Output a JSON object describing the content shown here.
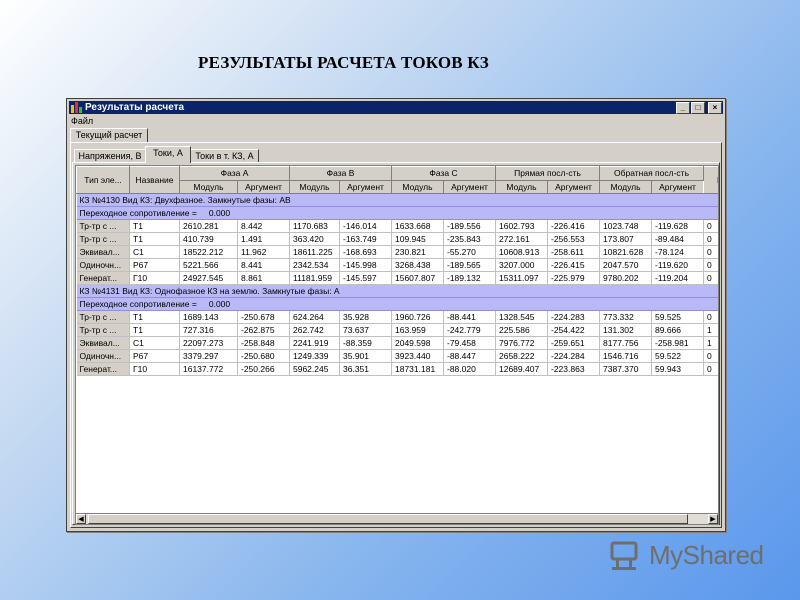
{
  "slide": {
    "title": "РЕЗУЛЬТАТЫ РАСЧЕТА ТОКОВ КЗ"
  },
  "window": {
    "title": "Результаты расчета",
    "menu": [
      "Файл"
    ],
    "outer_tab": "Текущий расчет",
    "tabs": [
      "Напряжения, В",
      "Токи, А",
      "Токи в т. КЗ, А"
    ],
    "active_tab": "Токи, А"
  },
  "table": {
    "group_headers": [
      "Тип эле...",
      "Название",
      "Фаза A",
      "Фаза B",
      "Фаза C",
      "Прямая посл-сть",
      "Обратная посл-сть",
      "Н"
    ],
    "sub_headers": [
      "Модуль",
      "Аргумент"
    ],
    "sections": [
      {
        "header": "КЗ №4130 Вид КЗ: Двухфазное. Замкнутые фазы: AB",
        "resistance_label": "Переходное сопротивление =",
        "resistance_value": "0.000",
        "rows": [
          [
            "Тр-тр с ...",
            "T1",
            "2610.281",
            "8.442",
            "1170.683",
            "-146.014",
            "1633.668",
            "-189.556",
            "1602.793",
            "-226.416",
            "1023.748",
            "-119.628",
            "0"
          ],
          [
            "Тр-тр с ...",
            "T1",
            "410.739",
            "1.491",
            "363.420",
            "-163.749",
            "109.945",
            "-235.843",
            "272.161",
            "-256.553",
            "173.807",
            "-89.484",
            "0"
          ],
          [
            "Эквивал...",
            "C1",
            "18522.212",
            "11.962",
            "18611.225",
            "-168.693",
            "230.821",
            "-55.270",
            "10608.913",
            "-258.611",
            "10821.628",
            "-78.124",
            "0"
          ],
          [
            "Одиночн...",
            "P67",
            "5221.566",
            "8.441",
            "2342.534",
            "-145.998",
            "3268.438",
            "-189.565",
            "3207.000",
            "-226.415",
            "2047.570",
            "-119.620",
            "0"
          ],
          [
            "Генерат...",
            "Г10",
            "24927.545",
            "8.861",
            "11181.959",
            "-145.597",
            "15607.807",
            "-189.132",
            "15311.097",
            "-225.979",
            "9780.202",
            "-119.204",
            "0"
          ]
        ]
      },
      {
        "header": "КЗ №4131 Вид КЗ: Однофазное КЗ на землю. Замкнутые фазы: A",
        "resistance_label": "Переходное сопротивление =",
        "resistance_value": "0.000",
        "rows": [
          [
            "Тр-тр с ...",
            "T1",
            "1689.143",
            "-250.678",
            "624.264",
            "35.928",
            "1960.726",
            "-88.441",
            "1328.545",
            "-224.283",
            "773.332",
            "59.525",
            "0"
          ],
          [
            "Тр-тр с ...",
            "T1",
            "727.316",
            "-262.875",
            "262.742",
            "73.637",
            "163.959",
            "-242.779",
            "225.586",
            "-254.422",
            "131.302",
            "89.666",
            "1"
          ],
          [
            "Эквивал...",
            "C1",
            "22097.273",
            "-258.848",
            "2241.919",
            "-88.359",
            "2049.598",
            "-79.458",
            "7976.772",
            "-259.651",
            "8177.756",
            "-258.981",
            "1"
          ],
          [
            "Одиночн...",
            "P67",
            "3379.297",
            "-250.680",
            "1249.339",
            "35.901",
            "3923.440",
            "-88.447",
            "2658.222",
            "-224.284",
            "1546.716",
            "59.522",
            "0"
          ],
          [
            "Генерат...",
            "Г10",
            "16137.772",
            "-250.266",
            "5962.245",
            "36.351",
            "18731.181",
            "-88.020",
            "12689.407",
            "-223.863",
            "7387.370",
            "59.943",
            "0"
          ]
        ]
      }
    ]
  },
  "logo": {
    "text": "MyShared"
  },
  "colors": {
    "section_bg": "#b9b9f8",
    "titlebar": "#0a246a",
    "window_bg": "#d4d0c8"
  }
}
